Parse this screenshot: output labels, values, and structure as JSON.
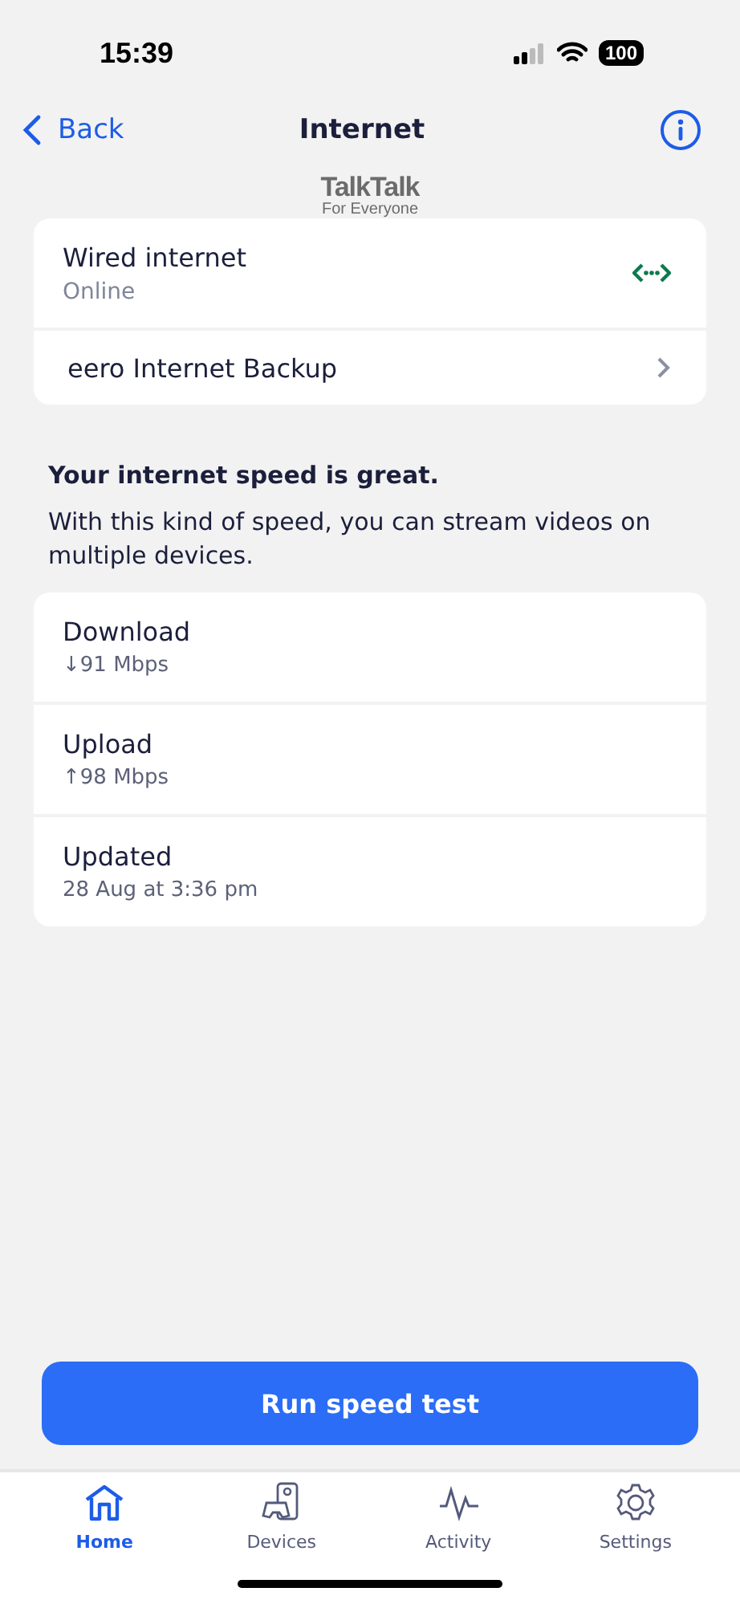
{
  "status_bar": {
    "time": "15:39",
    "battery": "100"
  },
  "nav": {
    "back": "Back",
    "title": "Internet"
  },
  "logo": {
    "name": "TalkTalk",
    "tagline": "For Everyone"
  },
  "connection": [
    {
      "kind": "status",
      "title": "Wired internet",
      "subtitle": "Online"
    },
    {
      "kind": "link",
      "title": "eero Internet Backup"
    }
  ],
  "summary": {
    "heading": "Your internet speed is great.",
    "body": "With this kind of speed, you can stream videos on multiple devices."
  },
  "stats": [
    {
      "label": "Download",
      "arrow": "↓",
      "value": "91 Mbps"
    },
    {
      "label": "Upload",
      "arrow": "↑",
      "value": "98 Mbps"
    },
    {
      "label": "Updated",
      "value": "28 Aug at 3:36 pm"
    }
  ],
  "action": "Run speed test",
  "tabs": [
    {
      "kind": "home",
      "label": "Home",
      "selected": true
    },
    {
      "kind": "devices",
      "label": "Devices",
      "selected": false
    },
    {
      "kind": "activity",
      "label": "Activity",
      "selected": false
    },
    {
      "kind": "settings",
      "label": "Settings",
      "selected": false
    }
  ]
}
